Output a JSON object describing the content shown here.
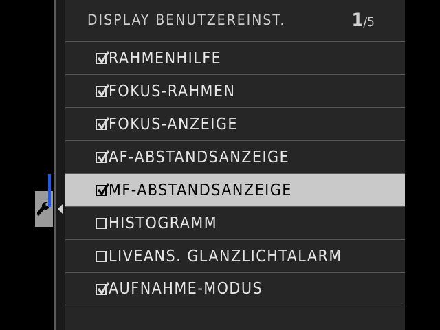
{
  "header": {
    "title": "DISPLAY BENUTZEREINST.",
    "page_current": "1",
    "page_separator": "/",
    "page_total": "5"
  },
  "sidebar": {
    "active_tab_icon": "wrench-icon"
  },
  "menu": {
    "items": [
      {
        "label": "RAHMENHILFE",
        "checked": true
      },
      {
        "label": "FOKUS-RAHMEN",
        "checked": true
      },
      {
        "label": "FOKUS-ANZEIGE",
        "checked": true
      },
      {
        "label": "AF-ABSTANDSANZEIGE",
        "checked": true
      },
      {
        "label": "MF-ABSTANDSANZEIGE",
        "checked": true,
        "selected": true
      },
      {
        "label": "HISTOGRAMM",
        "checked": false
      },
      {
        "label": "LIVEANS. GLANZLICHTALARM",
        "checked": false
      },
      {
        "label": "AUFNAHME-MODUS",
        "checked": true
      }
    ]
  },
  "colors": {
    "selection_bar": "#c9c9c9",
    "selection_accent": "#1e5ae6",
    "panel_background": "#262626"
  }
}
